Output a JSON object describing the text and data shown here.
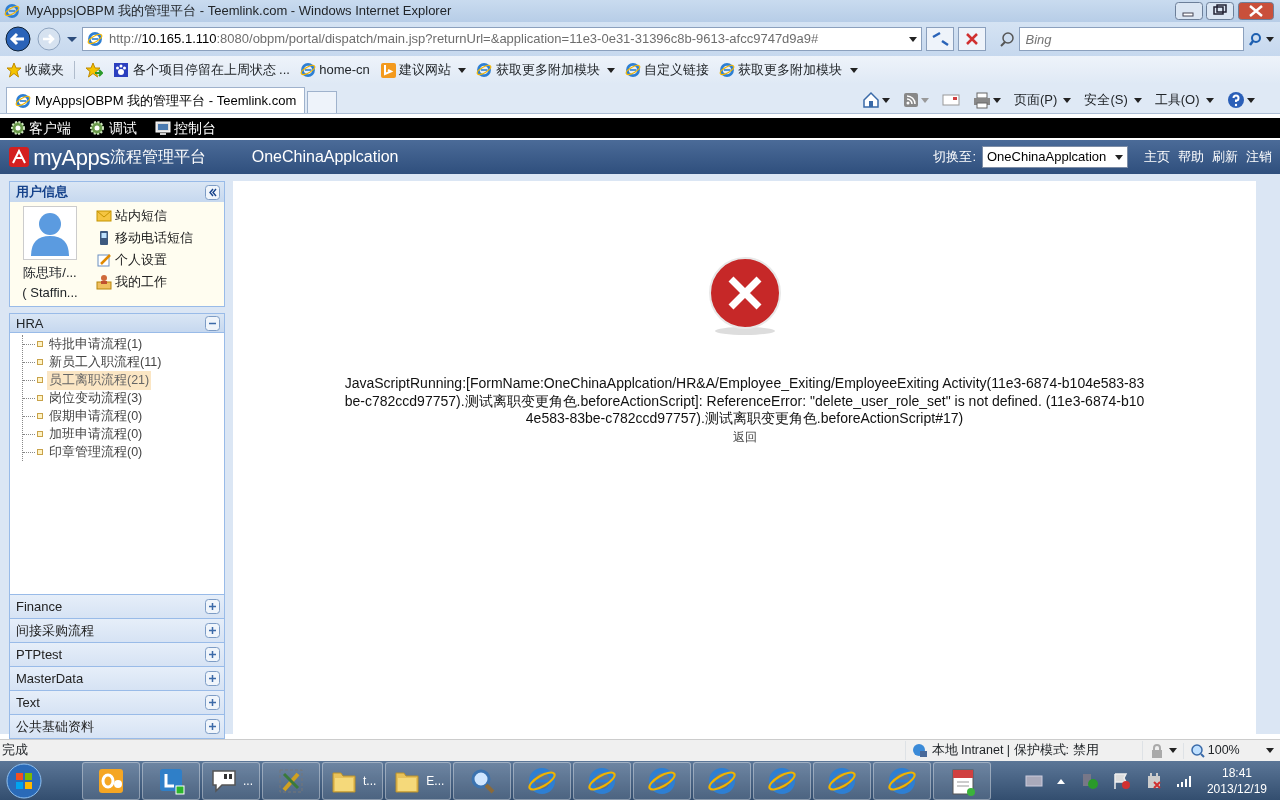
{
  "window": {
    "title": "MyApps|OBPM 我的管理平台 - Teemlink.com - Windows Internet Explorer"
  },
  "address_bar": {
    "scheme": "http://",
    "host": "10.165.1.110",
    "path": ":8080/obpm/portal/dispatch/main.jsp?returnUrl=&application=11e3-0e31-31396c8b-9613-afcc9747d9a9#"
  },
  "search": {
    "placeholder": "Bing"
  },
  "favorites": [
    {
      "label": "收藏夹",
      "kind": "star",
      "dropdown": false
    },
    {
      "label": "各个项目停留在上周状态 ...",
      "kind": "paw",
      "dropdown": false
    },
    {
      "label": "home-cn",
      "kind": "ie",
      "dropdown": false
    },
    {
      "label": "建议网站",
      "kind": "bing",
      "dropdown": true
    },
    {
      "label": "获取更多附加模块",
      "kind": "ie",
      "dropdown": true
    },
    {
      "label": "自定义链接",
      "kind": "ie",
      "dropdown": false
    },
    {
      "label": "获取更多附加模块",
      "kind": "ie",
      "dropdown": true
    }
  ],
  "tabs": [
    {
      "label": "MyApps|OBPM 我的管理平台 - Teemlink.com",
      "selected": true
    }
  ],
  "command_bar": [
    {
      "label": "页面(P)"
    },
    {
      "label": "安全(S)"
    },
    {
      "label": "工具(O)"
    }
  ],
  "top_menu": [
    {
      "label": "客户端",
      "kind": "gear"
    },
    {
      "label": "调试",
      "kind": "gear"
    },
    {
      "label": "控制台",
      "kind": "monitor"
    }
  ],
  "header": {
    "brand": "myApps",
    "brand_sub": "流程管理平台",
    "app_name": "OneChinaApplcation",
    "switch_label": "切换至:",
    "switch_value": "OneChinaApplcation",
    "links": [
      "主页",
      "帮助",
      "刷新",
      "注销"
    ]
  },
  "user_panel": {
    "title": "用户信息",
    "user_name": "陈思玮/...",
    "user_role": "( Staffin...",
    "actions": [
      {
        "label": "站内短信",
        "kind": "mail"
      },
      {
        "label": "移动电话短信",
        "kind": "phone"
      },
      {
        "label": "个人设置",
        "kind": "edit"
      },
      {
        "label": "我的工作",
        "kind": "work"
      }
    ]
  },
  "modules": [
    {
      "title": "HRA",
      "expanded": true,
      "items": [
        {
          "label": "特批申请流程(1)",
          "selected": false
        },
        {
          "label": "新员工入职流程(11)",
          "selected": false
        },
        {
          "label": "员工离职流程(21)",
          "selected": true
        },
        {
          "label": "岗位变动流程(3)",
          "selected": false
        },
        {
          "label": "假期申请流程(0)",
          "selected": false
        },
        {
          "label": "加班申请流程(0)",
          "selected": false
        },
        {
          "label": "印章管理流程(0)",
          "selected": false
        }
      ]
    },
    {
      "title": "Finance",
      "expanded": false
    },
    {
      "title": "间接采购流程",
      "expanded": false
    },
    {
      "title": "PTPtest",
      "expanded": false
    },
    {
      "title": "MasterData",
      "expanded": false
    },
    {
      "title": "Text",
      "expanded": false
    },
    {
      "title": "公共基础资料",
      "expanded": false
    }
  ],
  "error": {
    "message": "JavaScriptRunning:[FormName:OneChinaApplcation/HR&A/Employee_Exiting/EmployeeExiting Activity(11e3-6874-b104e583-83be-c782ccd97757).测试离职变更角色.beforeActionScript]: ReferenceError: \"delete_user_role_set\" is not defined. (11e3-6874-b104e583-83be-c782ccd97757).测试离职变更角色.beforeActionScript#17)",
    "back_link": "返回"
  },
  "status_bar": {
    "text": "完成",
    "zone": "本地 Intranet | 保护模式: 禁用",
    "zoom": "100%"
  },
  "taskbar": {
    "items": [
      {
        "kind": "outlook"
      },
      {
        "kind": "lync"
      },
      {
        "kind": "chat",
        "label": "..."
      },
      {
        "kind": "tool"
      },
      {
        "kind": "folder",
        "label": "t..."
      },
      {
        "kind": "folder",
        "label": "E..."
      },
      {
        "kind": "magnifier"
      },
      {
        "kind": "ie"
      },
      {
        "kind": "ie"
      },
      {
        "kind": "ie"
      },
      {
        "kind": "ie"
      },
      {
        "kind": "ie"
      },
      {
        "kind": "ie"
      },
      {
        "kind": "ie"
      },
      {
        "kind": "notepad"
      }
    ],
    "time": "18:41",
    "date": "2013/12/19"
  }
}
